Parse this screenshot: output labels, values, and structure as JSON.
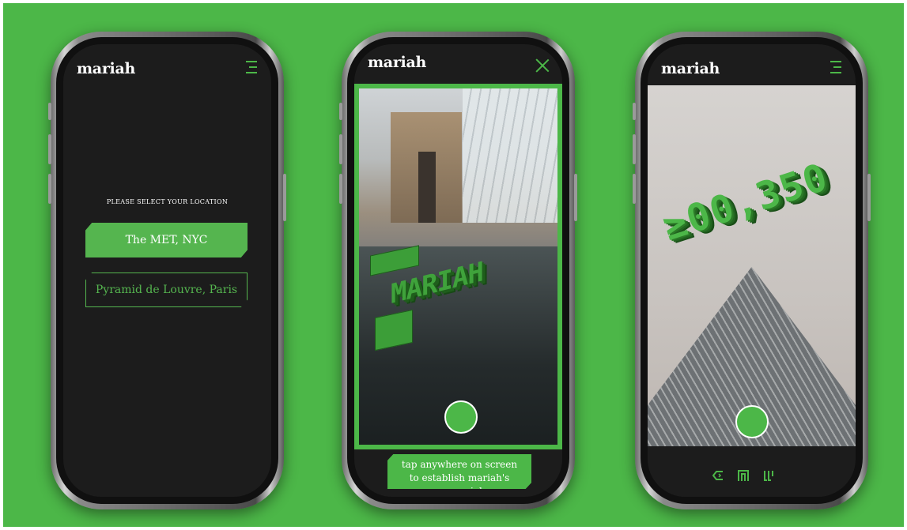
{
  "brand": {
    "name": "mariah",
    "accent": "#4cb748",
    "background": "#4cb748",
    "screen": "#1c1c1c"
  },
  "phone1": {
    "prompt": "PLEASE SELECT YOUR LOCATION",
    "locations": [
      {
        "label": "The MET, NYC",
        "selected": true
      },
      {
        "label": "Pyramid de Louvre, Paris",
        "selected": false
      }
    ],
    "menu_icon": "menu-icon"
  },
  "phone2": {
    "close_icon": "close-icon",
    "ar_text": "MARIAH",
    "caption_line1": "tap anywhere on screen",
    "caption_line2": "to establish mariah's memorial"
  },
  "phone3": {
    "counter": "≥00,350",
    "menu_icon": "menu-icon",
    "nav_icons": [
      "back-icon",
      "home-icon",
      "gallery-icon"
    ]
  }
}
